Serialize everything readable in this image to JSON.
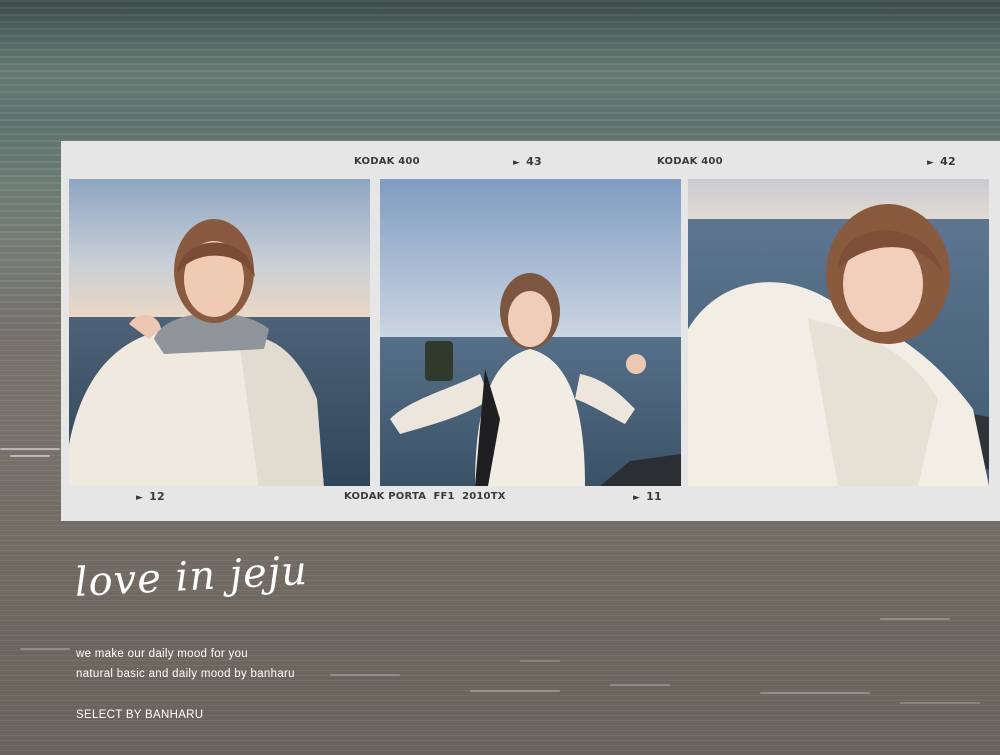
{
  "film_strip": {
    "top_labels": [
      {
        "kind": "brand",
        "text": "KODAK 400"
      },
      {
        "kind": "frame",
        "text": "43"
      },
      {
        "kind": "brand",
        "text": "KODAK 400"
      },
      {
        "kind": "frame",
        "text": "42"
      }
    ],
    "bottom_labels": [
      {
        "kind": "frame",
        "text": "12"
      },
      {
        "kind": "brand",
        "text": "KODAK PORTA  FF1  2010TX"
      },
      {
        "kind": "frame",
        "text": "11"
      }
    ],
    "photos": [
      {
        "description": "selfie-white-fur-coat-by-sea"
      },
      {
        "description": "holding-phone-white-fur-coat-by-sea"
      },
      {
        "description": "selfie-white-fur-coat-closeup"
      }
    ]
  },
  "text": {
    "title": "love in jeju",
    "line1": "we make our daily mood for you",
    "line2": "natural basic and daily mood by banharu",
    "signature": "SELECT BY BANHARU"
  },
  "colors": {
    "film": "#e6e6e6",
    "coat": "#f1ece4",
    "sea": "#4e6270",
    "sky_top": "#93aac4"
  }
}
